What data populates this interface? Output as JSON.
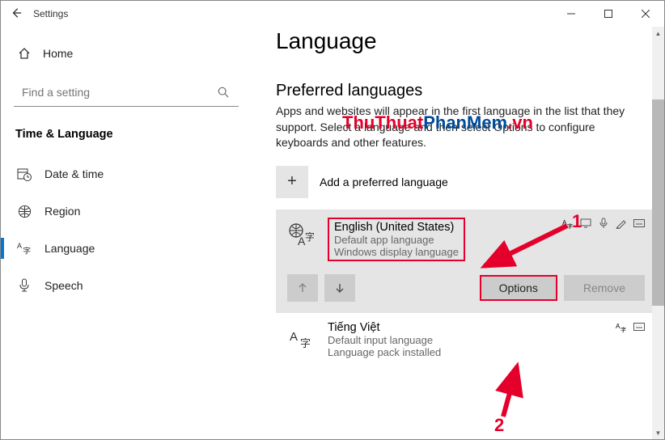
{
  "window": {
    "title": "Settings"
  },
  "sidebar": {
    "home": "Home",
    "search_placeholder": "Find a setting",
    "section": "Time & Language",
    "items": [
      {
        "label": "Date & time"
      },
      {
        "label": "Region"
      },
      {
        "label": "Language"
      },
      {
        "label": "Speech"
      }
    ]
  },
  "page": {
    "title": "Language",
    "subheading": "Preferred languages",
    "description": "Apps and websites will appear in the first language in the list that they support. Select a language and then select Options to configure keyboards and other features.",
    "add_language": "Add a preferred language"
  },
  "languages": [
    {
      "name": "English (United States)",
      "sub1": "Default app language",
      "sub2": "Windows display language",
      "options": "Options",
      "remove": "Remove"
    },
    {
      "name": "Tiếng Việt",
      "sub1": "Default input language",
      "sub2": "Language pack installed"
    }
  ],
  "watermark": {
    "part1": "ThuThuat",
    "part2": "PhanMem",
    "part3": ".vn"
  },
  "annotations": {
    "one": "1",
    "two": "2"
  }
}
